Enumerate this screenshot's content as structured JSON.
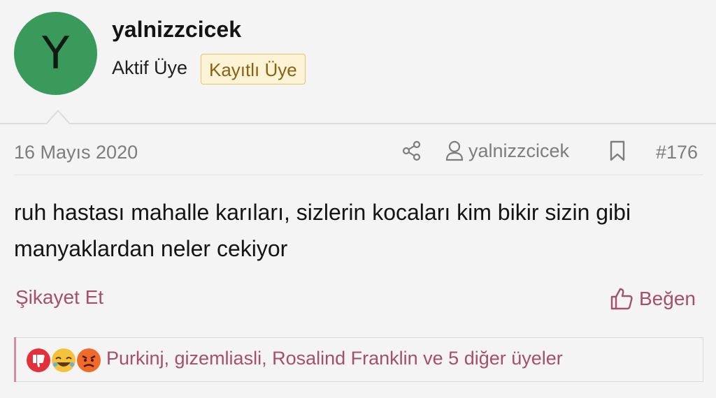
{
  "user": {
    "avatar_letter": "Y",
    "avatar_color": "#3a9a5b",
    "name": "yalnizzcicek",
    "title": "Aktif Üye",
    "badge": "Kayıtlı Üye"
  },
  "post": {
    "date": "16 Mayıs 2020",
    "author": "yalnizzcicek",
    "number": "#176",
    "message": "ruh hastası mahalle karıları, sizlerin kocaları kim bikir sizin gibi manyaklardan neler cekiyor"
  },
  "actions": {
    "report_label": "Şikayet Et",
    "like_label": "Beğen"
  },
  "reactions": {
    "icons": [
      "thumbs-down-reaction-icon",
      "laughing-reaction-icon",
      "angry-reaction-icon"
    ],
    "summary": "Purkinj, gizemliasli, Rosalind Franklin ve 5 diğer üyeler"
  },
  "colors": {
    "accent": "#a4506c",
    "badge_bg": "#fdf3d6",
    "badge_border": "#e2c56b",
    "muted": "#7d7d7d"
  }
}
